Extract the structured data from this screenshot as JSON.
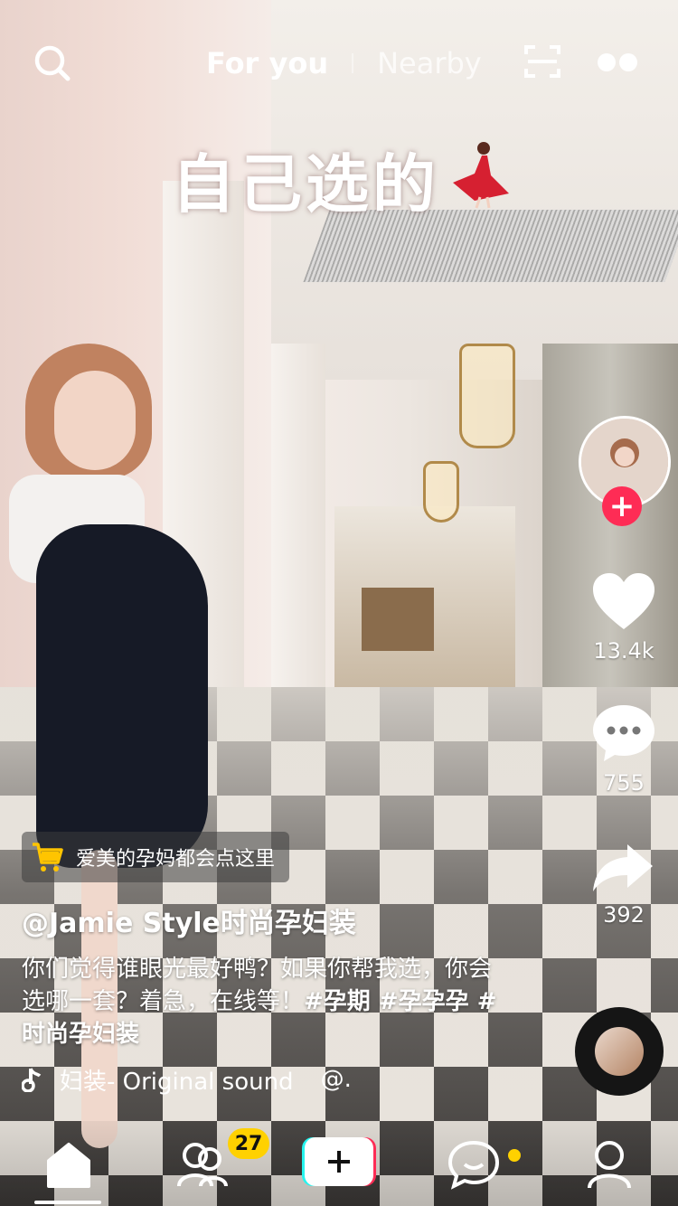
{
  "header": {
    "tabs": [
      {
        "label": "For you",
        "active": true
      },
      {
        "label": "Nearby",
        "active": false
      }
    ],
    "icons": [
      "search-icon",
      "scan-icon",
      "more-icon"
    ]
  },
  "video": {
    "overlay_text": "自己选的"
  },
  "actions": {
    "likes": "13.4k",
    "comments": "755",
    "shares": "392"
  },
  "shop_link": {
    "label": "爱美的孕妈都会点这里"
  },
  "post": {
    "username": "@Jamie Style时尚孕妇装",
    "caption": "你们觉得谁眼光最好鸭？如果你帮我选，你会选哪一套？着急，在线等！",
    "hashtags": "#孕期 #孕孕孕 #时尚孕妇装",
    "sound": "妇装- Original sound",
    "sound_more": "@."
  },
  "nav": {
    "friends_badge": "27",
    "accent_colors": {
      "red": "#fe2c55",
      "cyan": "#25f4ee",
      "yellow": "#ffd100"
    }
  }
}
